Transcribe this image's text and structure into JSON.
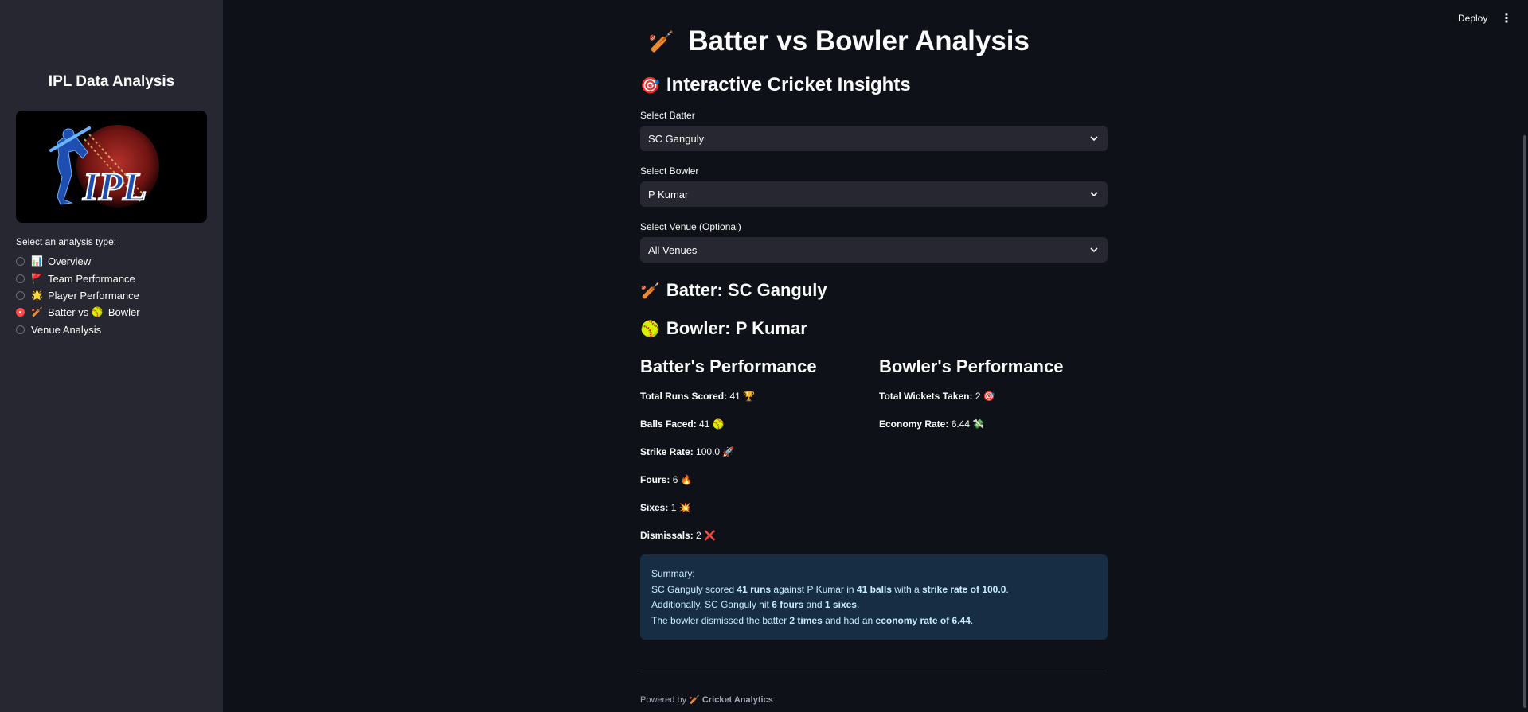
{
  "sidebar": {
    "title": "IPL Data Analysis",
    "logo_text": "IPL",
    "radio_label": "Select an analysis type:",
    "options": [
      {
        "icon": "📊",
        "label": "Overview",
        "selected": false
      },
      {
        "icon": "🚩",
        "label": "Team Performance",
        "selected": false
      },
      {
        "icon": "🌟",
        "label": "Player Performance",
        "selected": false
      },
      {
        "icon": "🏏",
        "label": "Batter vs ",
        "icon2": "🥎",
        "label2": "Bowler",
        "selected": true
      },
      {
        "icon": "",
        "label": "Venue Analysis",
        "selected": false
      }
    ]
  },
  "toolbar": {
    "deploy": "Deploy",
    "menu": "⋮"
  },
  "page": {
    "title_icon": "🏏",
    "title": "Batter vs Bowler Analysis",
    "subtitle_icon": "🎯",
    "subtitle": "Interactive Cricket Insights"
  },
  "filters": {
    "batter_label": "Select Batter",
    "batter_value": "SC Ganguly",
    "bowler_label": "Select Bowler",
    "bowler_value": "P Kumar",
    "venue_label": "Select Venue (Optional)",
    "venue_value": "All Venues"
  },
  "selection": {
    "batter_icon": "🏏",
    "batter_heading": "Batter: SC Ganguly",
    "bowler_icon": "🥎",
    "bowler_heading": "Bowler: P Kumar"
  },
  "batter_perf": {
    "heading": "Batter's Performance",
    "stats": [
      {
        "label": "Total Runs Scored:",
        "value": "41",
        "icon": "🏆"
      },
      {
        "label": "Balls Faced:",
        "value": "41",
        "icon": "🥎"
      },
      {
        "label": "Strike Rate:",
        "value": "100.0",
        "icon": "🚀"
      },
      {
        "label": "Fours:",
        "value": "6",
        "icon": "🔥"
      },
      {
        "label": "Sixes:",
        "value": "1",
        "icon": "💥"
      },
      {
        "label": "Dismissals:",
        "value": "2",
        "icon": "❌"
      }
    ]
  },
  "bowler_perf": {
    "heading": "Bowler's Performance",
    "stats": [
      {
        "label": "Total Wickets Taken:",
        "value": "2",
        "icon": "🎯"
      },
      {
        "label": "Economy Rate:",
        "value": "6.44",
        "icon": "💸"
      }
    ]
  },
  "summary": {
    "title": "Summary:",
    "line1": {
      "a": "SC Ganguly scored ",
      "b": "41 runs",
      "c": " against P Kumar in ",
      "d": "41 balls",
      "e": " with a ",
      "f": "strike rate of 100.0",
      "g": "."
    },
    "line2": {
      "a": "Additionally, SC Ganguly hit ",
      "b": "6 fours",
      "c": " and ",
      "d": "1 sixes",
      "e": "."
    },
    "line3": {
      "a": "The bowler dismissed the batter ",
      "b": "2 times",
      "c": " and had an ",
      "d": "economy rate of 6.44",
      "e": "."
    }
  },
  "footer": {
    "prefix": "Powered by ",
    "icon": "🏏",
    "brand": "Cricket Analytics"
  }
}
